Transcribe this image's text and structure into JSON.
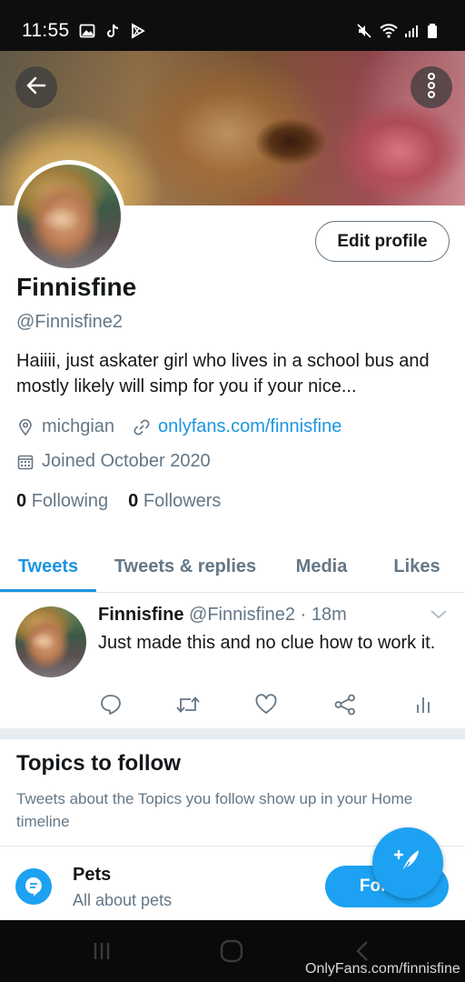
{
  "status_bar": {
    "time": "11:55",
    "icons_left": [
      "gallery-icon",
      "tiktok-icon",
      "play-store-icon"
    ],
    "icons_right": [
      "mute-icon",
      "wifi-icon",
      "signal-icon",
      "battery-icon"
    ]
  },
  "header": {
    "back_icon": "arrow-left-icon",
    "more_icon": "more-vertical-icon"
  },
  "profile": {
    "edit_button": "Edit profile",
    "display_name": "Finnisfine",
    "handle": "@Finnisfine2",
    "bio": "Haiiii, just askater girl who lives in a school bus and mostly likely will simp for you if your nice...",
    "location": "michgian",
    "website": "onlyfans.com/finnisfine",
    "joined": "Joined October 2020",
    "following_count": "0",
    "following_label": "Following",
    "followers_count": "0",
    "followers_label": "Followers"
  },
  "tabs": [
    {
      "label": "Tweets",
      "active": true
    },
    {
      "label": "Tweets & replies",
      "active": false
    },
    {
      "label": "Media",
      "active": false
    },
    {
      "label": "Likes",
      "active": false
    }
  ],
  "tweet": {
    "name": "Finnisfine",
    "handle": "@Finnisfine2",
    "separator": "·",
    "time": "18m",
    "text": "Just made this and no clue how to work it.",
    "actions": [
      "reply-icon",
      "retweet-icon",
      "like-icon",
      "share-icon",
      "analytics-icon"
    ]
  },
  "topics": {
    "title": "Topics to follow",
    "description": "Tweets about the Topics you follow show up in your Home timeline",
    "items": [
      {
        "name": "Pets",
        "subtitle": "All about pets",
        "button": "Follow"
      }
    ]
  },
  "fab": {
    "icon": "compose-tweet-icon"
  },
  "nav_bar": {
    "buttons": [
      "recents-icon",
      "home-icon",
      "back-icon"
    ]
  },
  "watermark": "OnlyFans.com/finnisfine",
  "colors": {
    "accent": "#1da1f2",
    "link": "#1b95e0",
    "secondary_text": "#657786"
  }
}
